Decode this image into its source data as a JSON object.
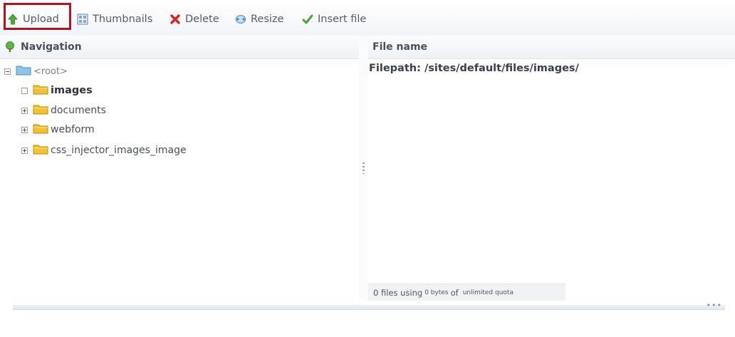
{
  "toolbar": {
    "upload": "Upload",
    "thumbnails": "Thumbnails",
    "delete": "Delete",
    "resize": "Resize",
    "insert_file": "Insert file"
  },
  "navigation": {
    "title": "Navigation",
    "root": "<root>",
    "folders": [
      "images",
      "documents",
      "webform",
      "css_injector_images_image"
    ],
    "selected": "images"
  },
  "files": {
    "header": "File name",
    "filepath": "Filepath: /sites/default/files/images/"
  },
  "status": {
    "count_text": "0 files using",
    "bytes_text": "0 bytes",
    "of_text": "of",
    "quota_text": "unlimited quota"
  },
  "footer": {
    "dots": "•••"
  },
  "colors": {
    "highlight_border": "#b3131b",
    "folder_yellow": "#f2c12e",
    "delete_red": "#d9221c",
    "insert_green": "#3fa82a",
    "resize_blue": "#3f8fd6"
  },
  "icons": [
    "upload-icon",
    "thumbnails-icon",
    "delete-icon",
    "resize-icon",
    "insert-file-icon",
    "tree-icon",
    "folder-icon",
    "root-folder-icon"
  ]
}
